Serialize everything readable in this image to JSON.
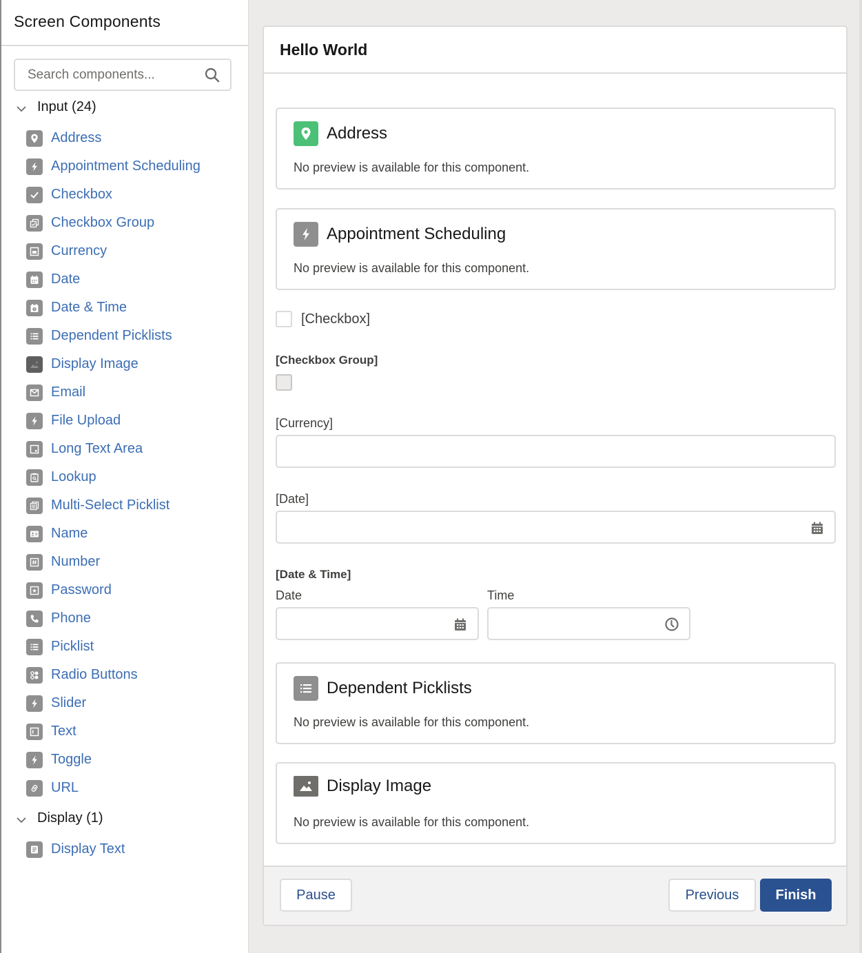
{
  "sidebar": {
    "title": "Screen Components",
    "search": {
      "placeholder": "Search components...",
      "value": ""
    },
    "sections": [
      {
        "label": "Input (24)",
        "items": [
          {
            "label": "Address",
            "icon": "location-pin-icon"
          },
          {
            "label": "Appointment Scheduling",
            "icon": "lightning-bolt-icon"
          },
          {
            "label": "Checkbox",
            "icon": "checkmark-icon"
          },
          {
            "label": "Checkbox Group",
            "icon": "checkbox-group-icon"
          },
          {
            "label": "Currency",
            "icon": "currency-icon"
          },
          {
            "label": "Date",
            "icon": "calendar-icon"
          },
          {
            "label": "Date & Time",
            "icon": "calendar-clock-icon"
          },
          {
            "label": "Dependent Picklists",
            "icon": "list-icon"
          },
          {
            "label": "Display Image",
            "icon": "image-icon"
          },
          {
            "label": "Email",
            "icon": "envelope-icon"
          },
          {
            "label": "File Upload",
            "icon": "lightning-bolt-icon"
          },
          {
            "label": "Long Text Area",
            "icon": "textarea-icon"
          },
          {
            "label": "Lookup",
            "icon": "lookup-icon"
          },
          {
            "label": "Multi-Select Picklist",
            "icon": "multi-select-icon"
          },
          {
            "label": "Name",
            "icon": "contact-card-icon"
          },
          {
            "label": "Number",
            "icon": "hash-icon"
          },
          {
            "label": "Password",
            "icon": "password-icon"
          },
          {
            "label": "Phone",
            "icon": "phone-icon"
          },
          {
            "label": "Picklist",
            "icon": "list-icon"
          },
          {
            "label": "Radio Buttons",
            "icon": "radio-buttons-icon"
          },
          {
            "label": "Slider",
            "icon": "lightning-bolt-icon"
          },
          {
            "label": "Text",
            "icon": "text-field-icon"
          },
          {
            "label": "Toggle",
            "icon": "lightning-bolt-icon"
          },
          {
            "label": "URL",
            "icon": "link-icon"
          }
        ]
      },
      {
        "label": "Display (1)",
        "items": [
          {
            "label": "Display Text",
            "icon": "display-text-icon"
          }
        ]
      }
    ]
  },
  "canvas": {
    "title": "Hello World",
    "cards": [
      {
        "title": "Address",
        "description": "No preview is available for this component.",
        "icon": "location-pin-icon",
        "icon_color": "#4bc076"
      },
      {
        "title": "Appointment Scheduling",
        "description": "No preview is available for this component.",
        "icon": "lightning-bolt-icon",
        "icon_color": "#8f8f8f"
      },
      {
        "title": "Dependent Picklists",
        "description": "No preview is available for this component.",
        "icon": "list-icon",
        "icon_color": "#8f8f8f"
      },
      {
        "title": "Display Image",
        "description": "No preview is available for this component.",
        "icon": "image-icon",
        "icon_color": "#706e6b"
      }
    ],
    "checkbox": {
      "label": "[Checkbox]",
      "checked": false
    },
    "checkbox_group": {
      "label": "[Checkbox Group]"
    },
    "currency": {
      "label": "[Currency]",
      "value": ""
    },
    "date": {
      "label": "[Date]",
      "value": ""
    },
    "date_time": {
      "label": "[Date & Time]",
      "date_label": "Date",
      "time_label": "Time",
      "date_value": "",
      "time_value": ""
    }
  },
  "footer": {
    "pause_label": "Pause",
    "previous_label": "Previous",
    "finish_label": "Finish"
  },
  "colors": {
    "link": "#3c6eb4",
    "brand_button": "#2a5190",
    "icon_gray": "#8f8f8f",
    "address_green": "#4bc076"
  }
}
